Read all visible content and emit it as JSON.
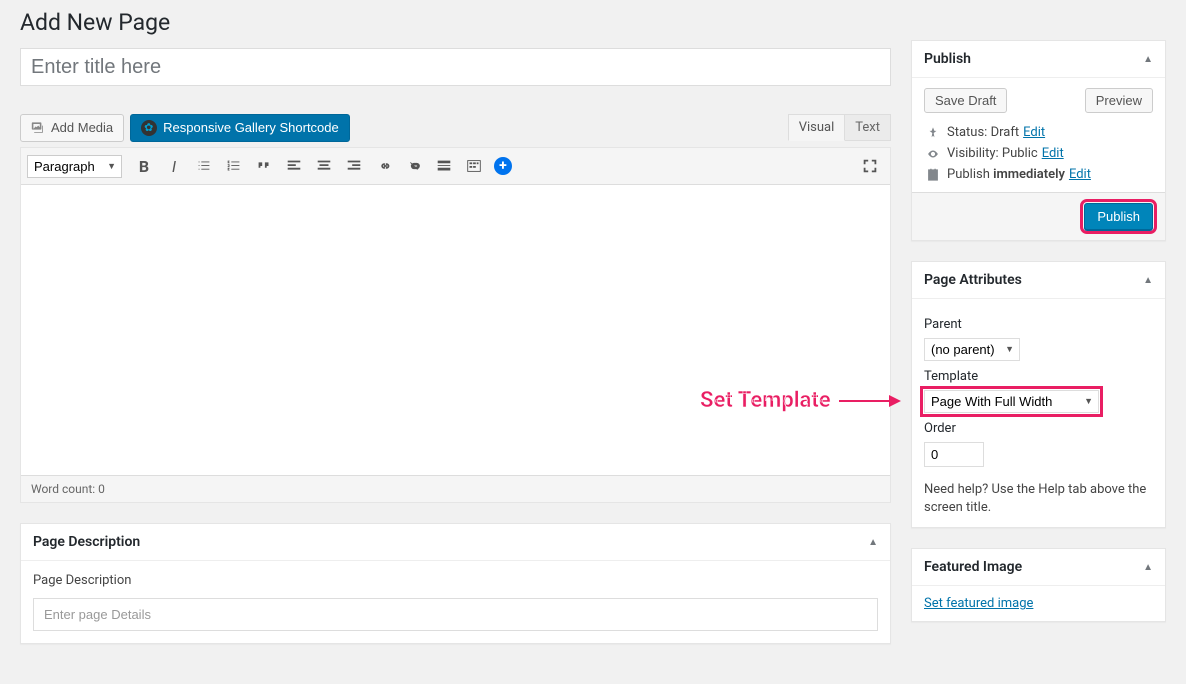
{
  "page_title": "Add New Page",
  "title_placeholder": "Enter title here",
  "media": {
    "add_media": "Add Media",
    "gallery_shortcode": "Responsive Gallery Shortcode"
  },
  "editor": {
    "tabs": {
      "visual": "Visual",
      "text": "Text"
    },
    "format_select": "Paragraph",
    "word_count_label": "Word count: 0"
  },
  "publish": {
    "title": "Publish",
    "save_draft": "Save Draft",
    "preview": "Preview",
    "status_label": "Status:",
    "status_value": "Draft",
    "visibility_label": "Visibility:",
    "visibility_value": "Public",
    "schedule_prefix": "Publish",
    "schedule_value": "immediately",
    "edit": "Edit",
    "publish_btn": "Publish"
  },
  "attributes": {
    "title": "Page Attributes",
    "parent_label": "Parent",
    "parent_value": "(no parent)",
    "template_label": "Template",
    "template_value": "Page With Full Width",
    "order_label": "Order",
    "order_value": "0",
    "help_text": "Need help? Use the Help tab above the screen title."
  },
  "featured": {
    "title": "Featured Image",
    "link": "Set featured image"
  },
  "description": {
    "title": "Page Description",
    "sub_label": "Page Description",
    "placeholder": "Enter page Details"
  },
  "annotation": "Set Template"
}
